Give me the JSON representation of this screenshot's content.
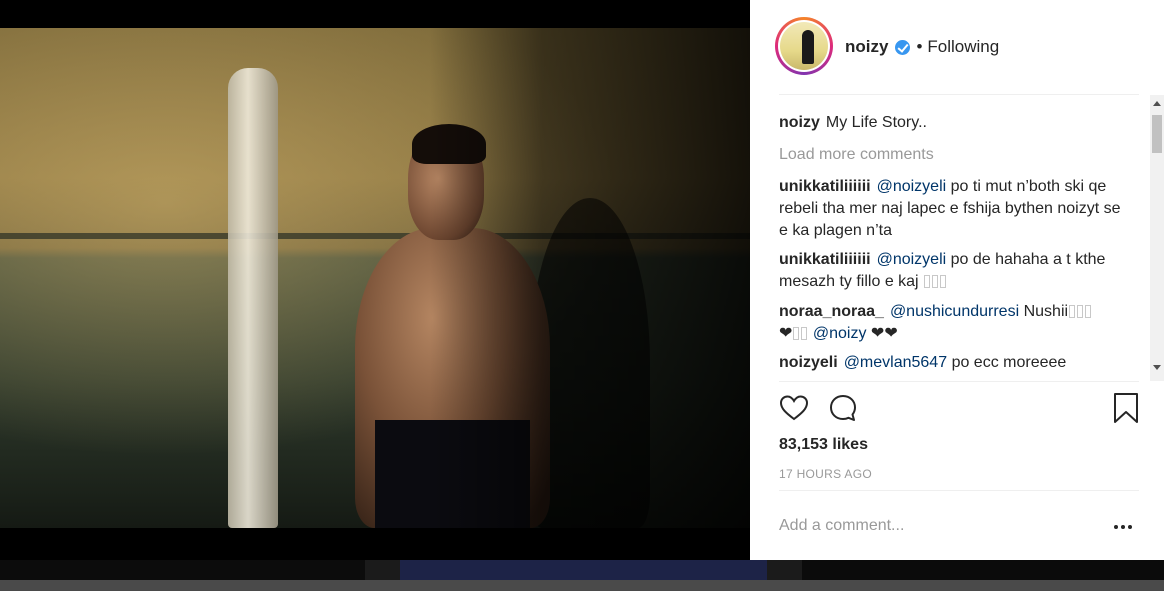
{
  "post": {
    "username": "noizy",
    "dot": "•",
    "follow_status": "Following"
  },
  "comments": {
    "caption": {
      "user": "noizy",
      "text": "My Life Story.."
    },
    "load_more": "Load more comments",
    "items": [
      {
        "user": "unikkatiliiiiii",
        "mention": "@noizyeli",
        "text": "po ti mut n’both ski qe rebeli tha mer naj lapec e fshija bythen noizyt se e ka plagen n’ta"
      },
      {
        "user": "unikkatiliiiiii",
        "mention": "@noizyeli",
        "text": "po de hahaha a t kthe mesazh ty fillo e kaj"
      },
      {
        "user": "noraa_noraa_",
        "mention": "@nushicundurresi",
        "text": "Nushii",
        "line2_prefix": "❤",
        "line2_mention": "@noizy",
        "line2_suffix": "❤❤"
      },
      {
        "user": "noizyeli",
        "mention": "@mevlan5647",
        "text": "po ecc moreeee"
      }
    ]
  },
  "stats": {
    "likes": "83,153 likes",
    "timestamp": "17 HOURS AGO"
  },
  "composer": {
    "placeholder": "Add a comment..."
  },
  "icons": {
    "like": "heart-icon",
    "comment": "comment-bubble-icon",
    "save": "bookmark-icon",
    "more": "more-options-icon",
    "verified": "verified-badge-icon"
  },
  "colors": {
    "verified": "#3897f0",
    "mention": "#003569",
    "muted": "#999999",
    "text": "#262626"
  }
}
